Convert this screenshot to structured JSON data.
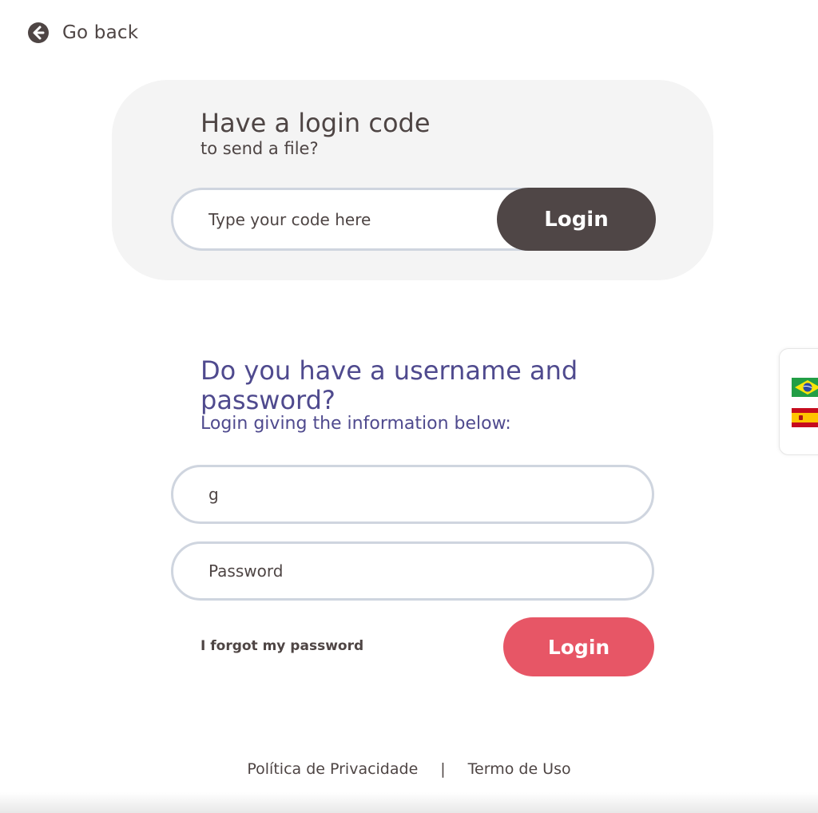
{
  "nav": {
    "go_back_label": "Go back",
    "go_back_icon": "arrow-left-circle-icon"
  },
  "code_card": {
    "title": "Have a login code",
    "subtitle": "to send a file?",
    "input_placeholder": "Type your code here",
    "input_value": "",
    "login_label": "Login"
  },
  "credentials": {
    "title": "Do you have a username and password?",
    "subtitle": "Login giving the information below:",
    "username_value": "g",
    "password_placeholder": "Password",
    "forgot_label": "I forgot my password",
    "login_label": "Login"
  },
  "footer": {
    "privacy_label": "Política de Privacidade",
    "separator": "|",
    "terms_label": "Termo de Uso"
  },
  "languages": [
    {
      "name": "brazil-flag-icon"
    },
    {
      "name": "spain-flag-icon"
    }
  ],
  "colors": {
    "text": "#4e4544",
    "heading_purple": "#4f4a8e",
    "dark_button": "#4f4646",
    "accent_red": "#e75666",
    "card_bg": "#f4f4f4",
    "input_border": "#cfd5df"
  }
}
